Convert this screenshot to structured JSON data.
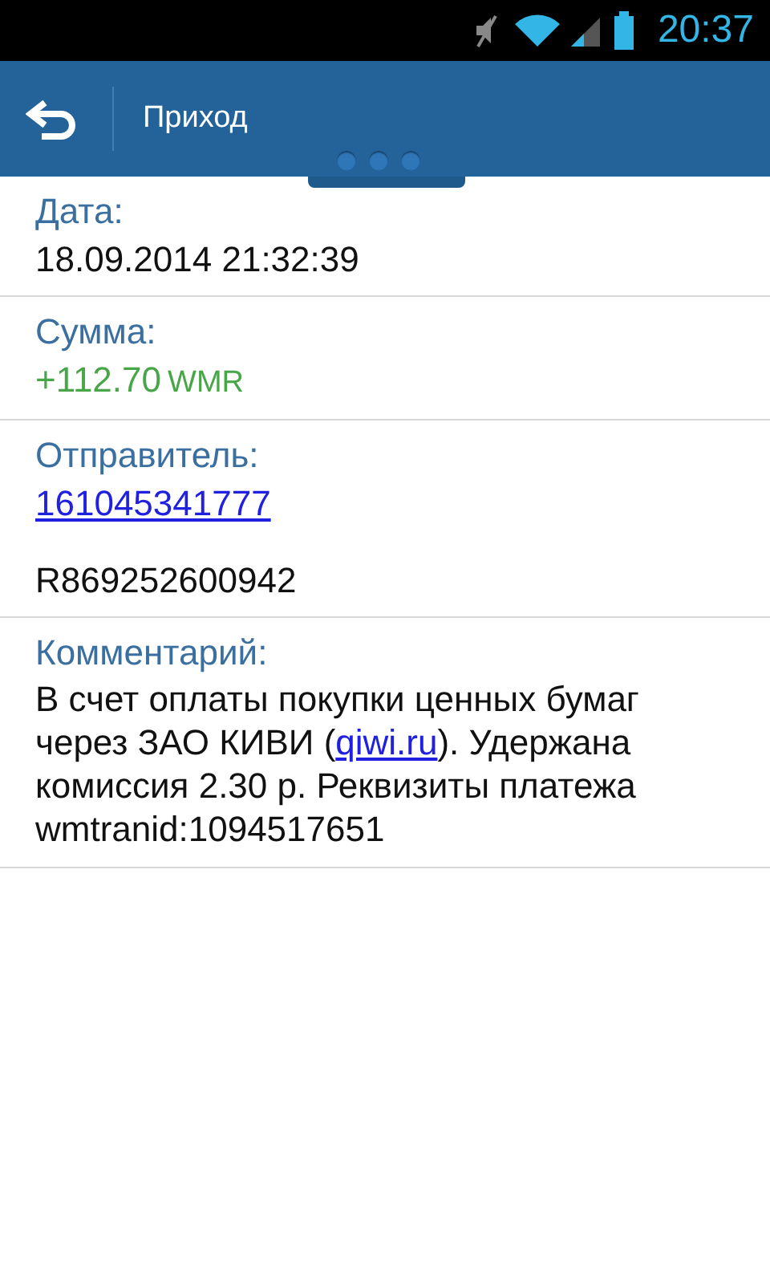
{
  "status_bar": {
    "time": "20:37"
  },
  "action_bar": {
    "title": "Приход",
    "page_dots": [
      {
        "selected": false
      },
      {
        "selected": false
      },
      {
        "selected": false
      }
    ]
  },
  "sections": [
    {
      "label": "Дата:",
      "values": [
        {
          "kind": "text",
          "text": "18.09.2014 21:32:39"
        }
      ]
    },
    {
      "label": "Сумма:",
      "values": [
        {
          "kind": "amount",
          "text": "+112.70",
          "currency": "WMR"
        }
      ]
    },
    {
      "label": "Отправитель:",
      "values": [
        {
          "kind": "link",
          "text": "161045341777"
        },
        {
          "kind": "text",
          "text": "R869252600942"
        }
      ]
    },
    {
      "label": "Комментарий:",
      "values": [
        {
          "kind": "comment",
          "before": "В счет оплаты покупки ценных бумаг через ЗАО КИВИ (",
          "link": "qiwi.ru",
          "after": "). Удержана комиссия 2.30 р. Реквизиты платежа wmtranid:1094517651"
        }
      ]
    }
  ]
}
